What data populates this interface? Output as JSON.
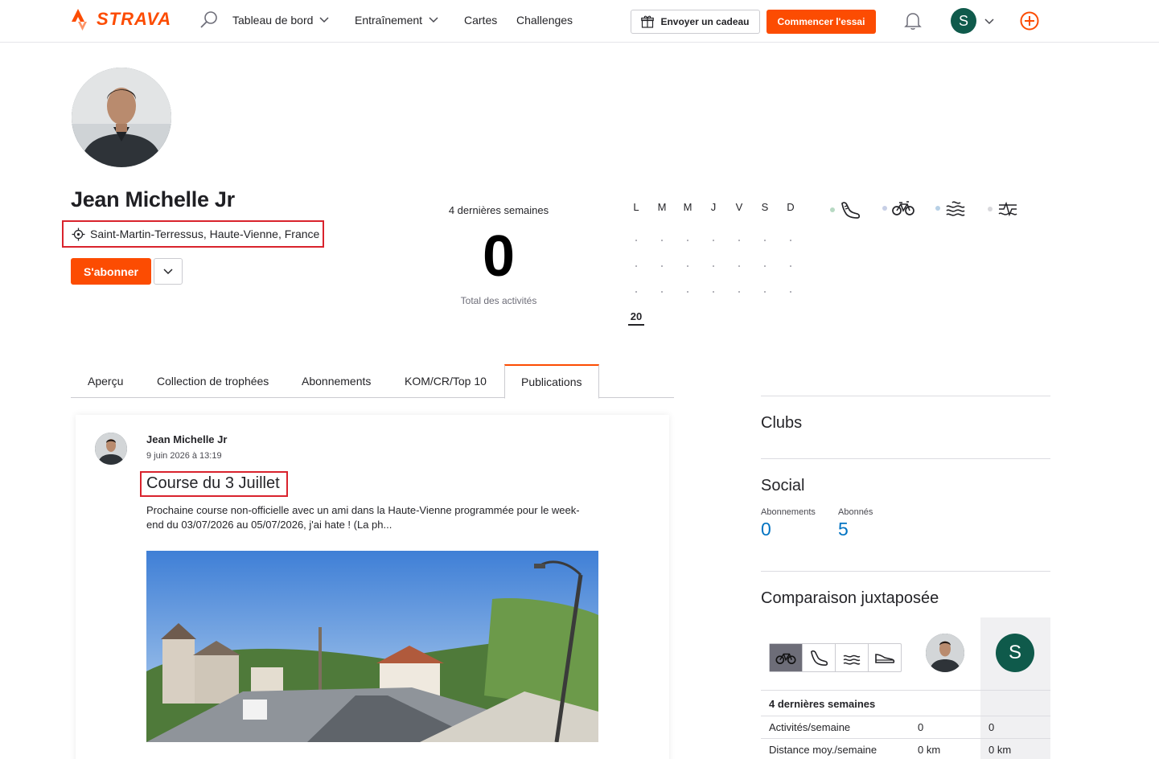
{
  "header": {
    "brand": "STRAVA",
    "nav": [
      {
        "label": "Tableau de bord",
        "has_dropdown": true
      },
      {
        "label": "Entraînement",
        "has_dropdown": true
      },
      {
        "label": "Cartes",
        "has_dropdown": false
      },
      {
        "label": "Challenges",
        "has_dropdown": false
      }
    ],
    "gift_label": "Envoyer un cadeau",
    "trial_label": "Commencer l'essai",
    "user_initial": "S"
  },
  "profile": {
    "name": "Jean Michelle Jr",
    "location": "Saint-Martin-Terressus, Haute-Vienne, France",
    "follow_label": "S'abonner"
  },
  "stats": {
    "period_label": "4 dernières semaines",
    "total": "0",
    "total_label": "Total des activités",
    "weekdays": [
      "L",
      "M",
      "M",
      "J",
      "V",
      "S",
      "D"
    ],
    "current_week": "20",
    "sports": [
      {
        "name": "run-icon",
        "dot": "#b7d9c3"
      },
      {
        "name": "bike-icon",
        "dot": "#c7cfe6"
      },
      {
        "name": "swim-icon",
        "dot": "#b7d0e6"
      },
      {
        "name": "other-icon",
        "dot": "#d8d8dc"
      }
    ]
  },
  "tabs": [
    {
      "label": "Aperçu",
      "active": false
    },
    {
      "label": "Collection de trophées",
      "active": false
    },
    {
      "label": "Abonnements",
      "active": false
    },
    {
      "label": "KOM/CR/Top 10",
      "active": false
    },
    {
      "label": "Publications",
      "active": true
    }
  ],
  "post": {
    "author": "Jean Michelle Jr",
    "date": "9 juin 2026 à 13:19",
    "title": "Course du 3 Juillet",
    "body": "Prochaine course non-officielle avec un ami dans la Haute-Vienne programmée pour le week-end du 03/07/2026 au 05/07/2026, j'ai hate ! (La ph..."
  },
  "sidebar": {
    "clubs_title": "Clubs",
    "social_title": "Social",
    "following_label": "Abonnements",
    "following_value": "0",
    "followers_label": "Abonnés",
    "followers_value": "5",
    "compare_title": "Comparaison juxtaposée",
    "compare_user_initial": "S",
    "compare_section": "4 dernières semaines",
    "compare_rows": [
      {
        "label": "Activités/semaine",
        "a": "0",
        "b": "0"
      },
      {
        "label": "Distance moy./semaine",
        "a": "0 km",
        "b": "0 km"
      }
    ]
  },
  "colors": {
    "brand": "#fc4c02",
    "link": "#0073c2",
    "highlight_box": "#d9232d",
    "avatar_bg": "#0f5a4b"
  }
}
